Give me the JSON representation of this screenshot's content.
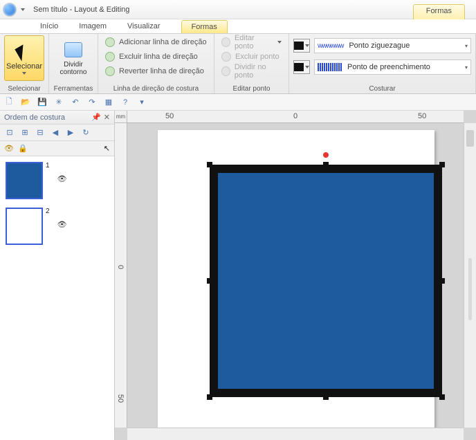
{
  "titlebar": {
    "title": "Sem título - Layout & Editing"
  },
  "topTabs": {
    "formas": "Formas"
  },
  "subnav": {
    "inicio": "Início",
    "imagem": "Imagem",
    "visualizar": "Visualizar",
    "formas": "Formas"
  },
  "ribbon": {
    "select": {
      "label": "Selecionar",
      "btn": "Selecionar"
    },
    "tools": {
      "label": "Ferramentas",
      "btn": "Dividir contorno"
    },
    "dir": {
      "label": "Linha de direção de costura",
      "add": "Adicionar linha de direção",
      "del": "Excluir linha de direção",
      "rev": "Reverter linha de direção"
    },
    "point": {
      "label": "Editar ponto",
      "edit": "Editar ponto",
      "del": "Excluir ponto",
      "div": "Dividir no ponto"
    },
    "sew": {
      "label": "Costurar",
      "line": "Ponto ziguezague",
      "fill": "Ponto de preenchimento"
    }
  },
  "panel": {
    "title": "Ordem de costura"
  },
  "layers": [
    {
      "num": "1",
      "fill": "blue"
    },
    {
      "num": "2",
      "fill": "white"
    }
  ],
  "ruler": {
    "unit": "mm",
    "h": {
      "t1": "50",
      "t2": "0",
      "t3": "50"
    },
    "v": {
      "t1": "0",
      "t2": "50"
    }
  }
}
